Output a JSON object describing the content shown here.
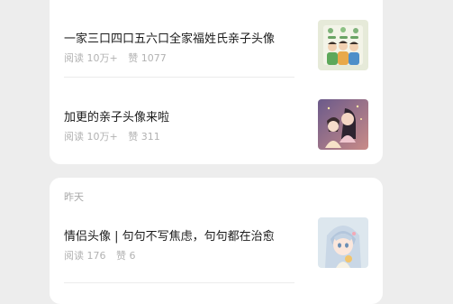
{
  "feed": {
    "groups": [
      {
        "date_label": "",
        "articles": [
          {
            "title": "一家三口四口五六口全家福姓氏亲子头像",
            "reads": "阅读 10万+",
            "likes": "赞 1077",
            "thumbnail": "family-cartoon-image"
          },
          {
            "title": "加更的亲子头像来啦",
            "reads": "阅读 10万+",
            "likes": "赞 311",
            "thumbnail": "mother-child-image"
          }
        ]
      },
      {
        "date_label": "昨天",
        "articles": [
          {
            "title": "情侣头像 | 句句不写焦虑，句句都在治愈",
            "reads": "阅读 176",
            "likes": "赞 6",
            "thumbnail": "anime-girl-image"
          }
        ]
      }
    ]
  }
}
